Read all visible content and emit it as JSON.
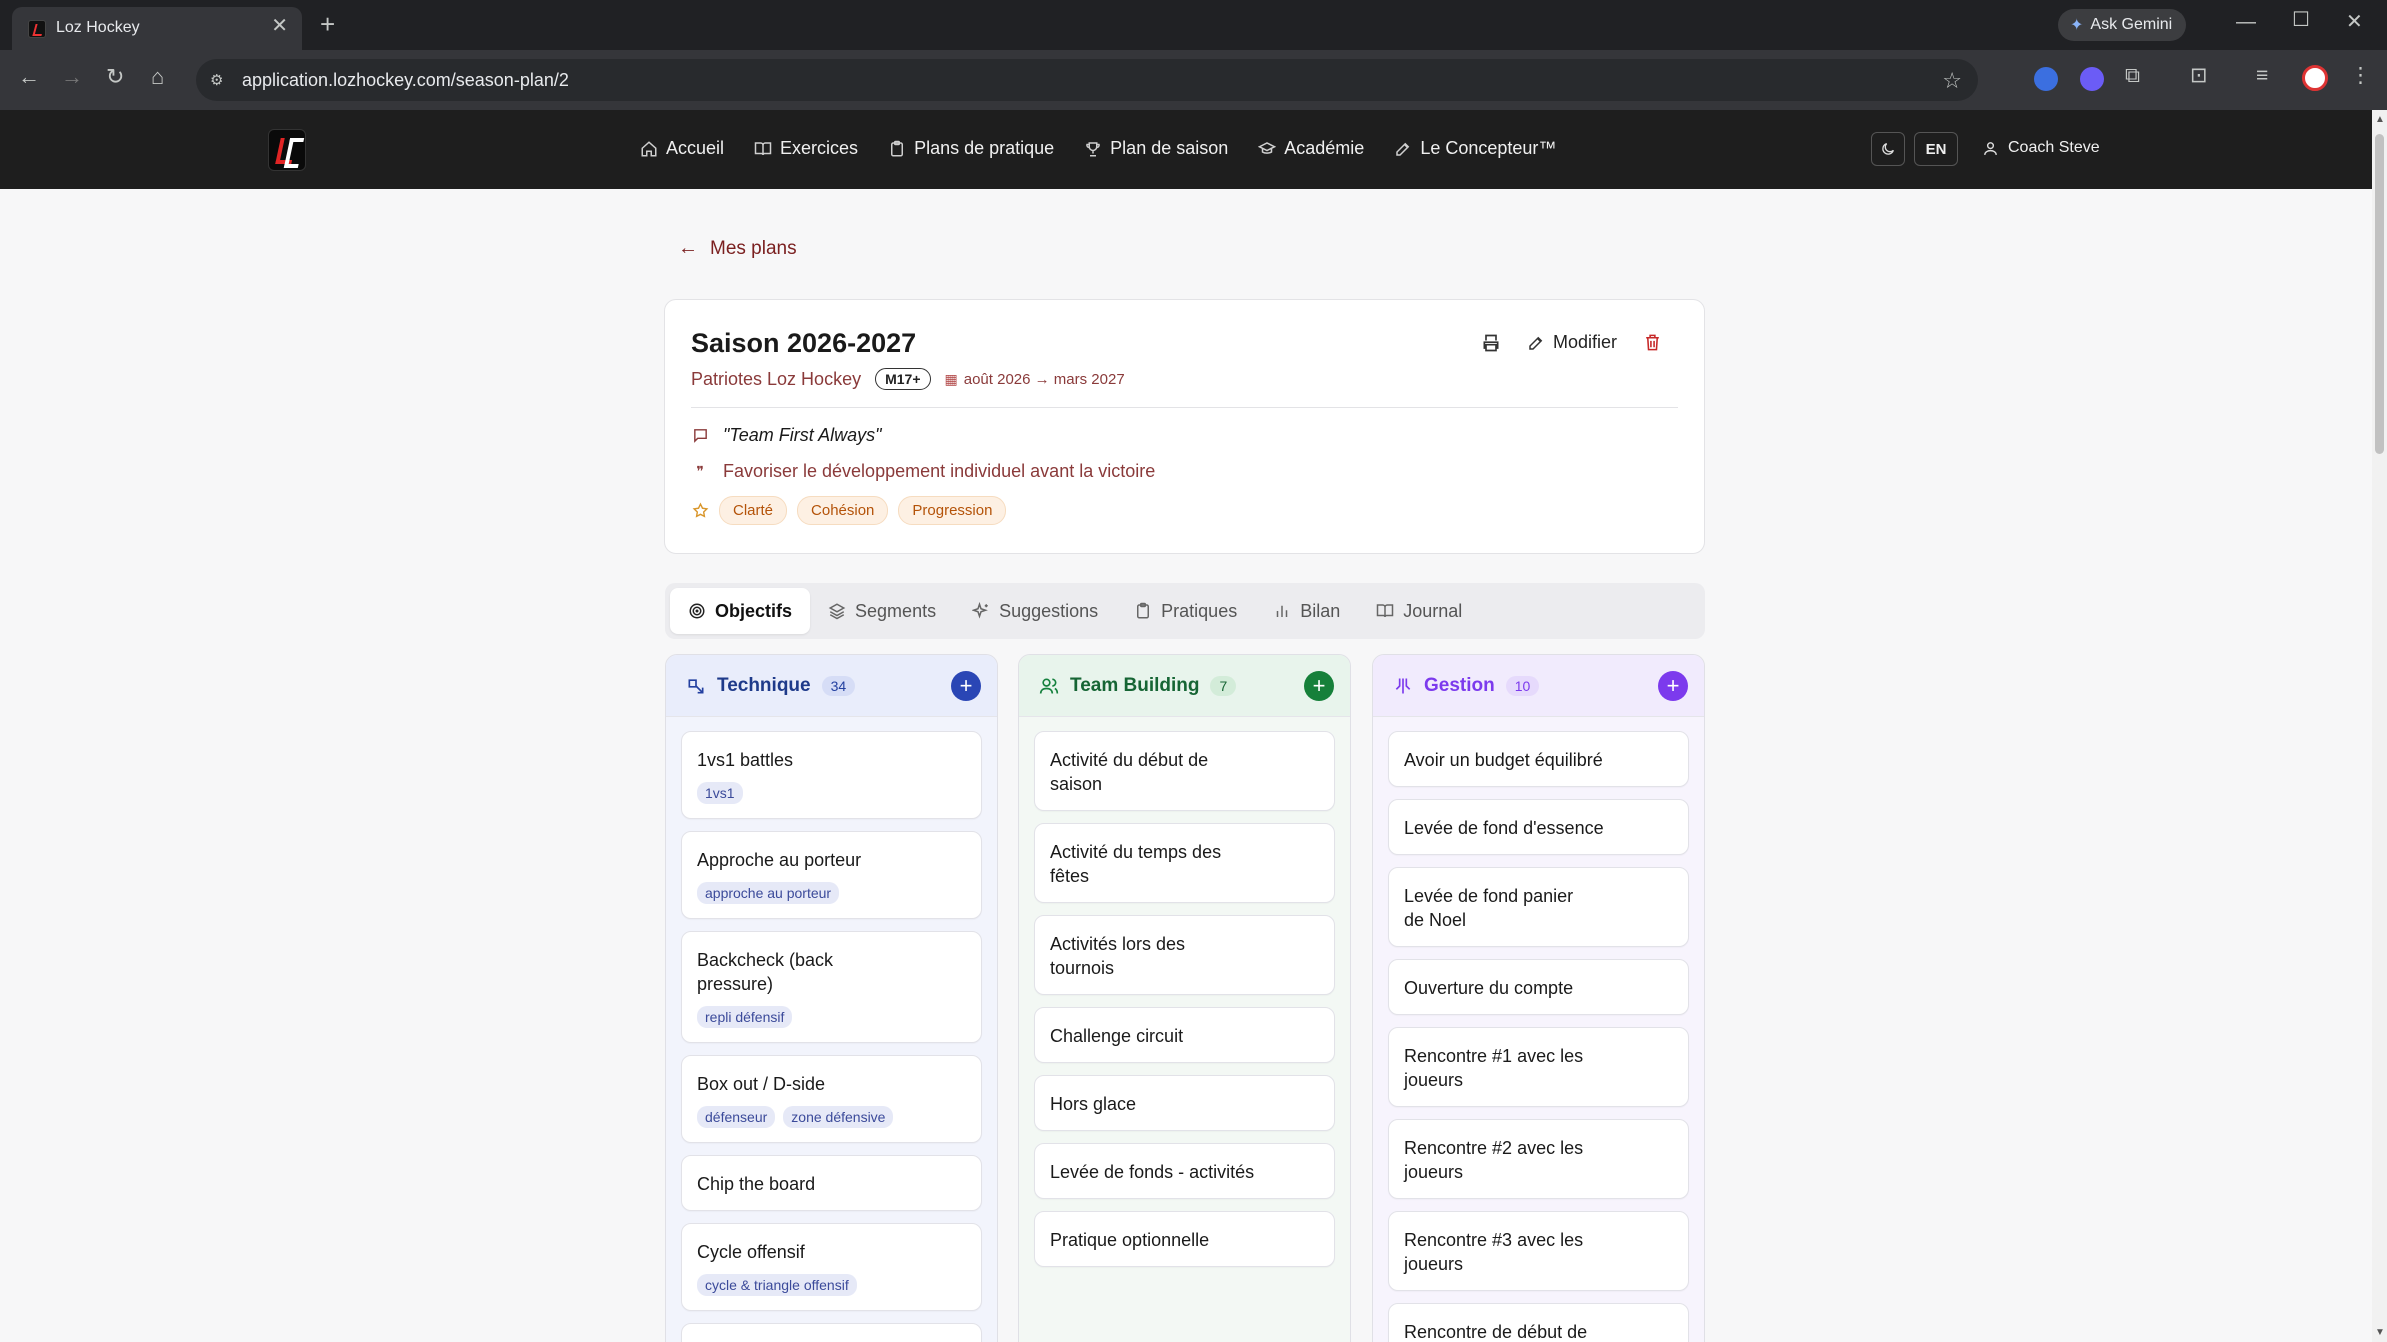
{
  "browser": {
    "tab_title": "Loz Hockey",
    "tab_close": "✕",
    "new_tab": "+",
    "url": "application.lozhockey.com/season-plan/2",
    "ask_gemini": "Ask Gemini"
  },
  "header": {
    "nav": [
      {
        "label": "Accueil",
        "icon": "home-icon"
      },
      {
        "label": "Exercices",
        "icon": "book-open-icon"
      },
      {
        "label": "Plans de pratique",
        "icon": "clipboard-icon"
      },
      {
        "label": "Plan de saison",
        "icon": "trophy-icon"
      },
      {
        "label": "Académie",
        "icon": "graduation-cap-icon"
      },
      {
        "label": "Le Concepteur™",
        "icon": "pencil-icon"
      }
    ],
    "lang": "EN",
    "user": "Coach Steve"
  },
  "back_link": "Mes plans",
  "plan": {
    "title": "Saison 2026-2027",
    "team": "Patriotes Loz Hockey",
    "age_group": "M17+",
    "dates": "août 2026 → mars 2027",
    "edit_label": "Modifier",
    "motto": "\"Team First Always\"",
    "philosophy": "Favoriser le développement individuel avant la victoire",
    "values": [
      "Clarté",
      "Cohésion",
      "Progression"
    ]
  },
  "tabs": [
    {
      "label": "Objectifs",
      "icon": "target-icon",
      "active": true
    },
    {
      "label": "Segments",
      "icon": "layers-icon",
      "active": false
    },
    {
      "label": "Suggestions",
      "icon": "sparkles-icon",
      "active": false
    },
    {
      "label": "Pratiques",
      "icon": "clipboard-icon",
      "active": false
    },
    {
      "label": "Bilan",
      "icon": "bar-chart-icon",
      "active": false
    },
    {
      "label": "Journal",
      "icon": "book-open-icon",
      "active": false
    }
  ],
  "columns": {
    "technique": {
      "title": "Technique",
      "count": "34",
      "accent": "#2a46b5",
      "items": [
        {
          "title": "1vs1 battles",
          "tags": [
            "1vs1"
          ]
        },
        {
          "title": "Approche au porteur",
          "tags": [
            "approche au porteur"
          ]
        },
        {
          "title": "Backcheck (back pressure)",
          "tags": [
            "repli défensif"
          ]
        },
        {
          "title": "Box out / D-side",
          "tags": [
            "défenseur",
            "zone défensive"
          ]
        },
        {
          "title": "Chip the board",
          "tags": []
        },
        {
          "title": "Cycle offensif",
          "tags": [
            "cycle & triangle offensif"
          ]
        },
        {
          "title": "",
          "tags": []
        }
      ]
    },
    "team_building": {
      "title": "Team Building",
      "count": "7",
      "accent": "#16803a",
      "items": [
        {
          "title": "Activité du début de saison"
        },
        {
          "title": "Activité du temps des fêtes"
        },
        {
          "title": "Activités lors des tournois"
        },
        {
          "title": "Challenge circuit"
        },
        {
          "title": "Hors glace"
        },
        {
          "title": "Levée de fonds - activités"
        },
        {
          "title": "Pratique optionnelle"
        }
      ]
    },
    "gestion": {
      "title": "Gestion",
      "count": "10",
      "accent": "#7c3aed",
      "items": [
        {
          "title": "Avoir un budget équilibré"
        },
        {
          "title": "Levée de fond d'essence"
        },
        {
          "title": "Levée de fond panier de Noel"
        },
        {
          "title": "Ouverture du compte"
        },
        {
          "title": "Rencontre #1 avec les joueurs"
        },
        {
          "title": "Rencontre #2 avec les joueurs"
        },
        {
          "title": "Rencontre #3 avec les joueurs"
        },
        {
          "title": "Rencontre de début de"
        }
      ]
    }
  }
}
